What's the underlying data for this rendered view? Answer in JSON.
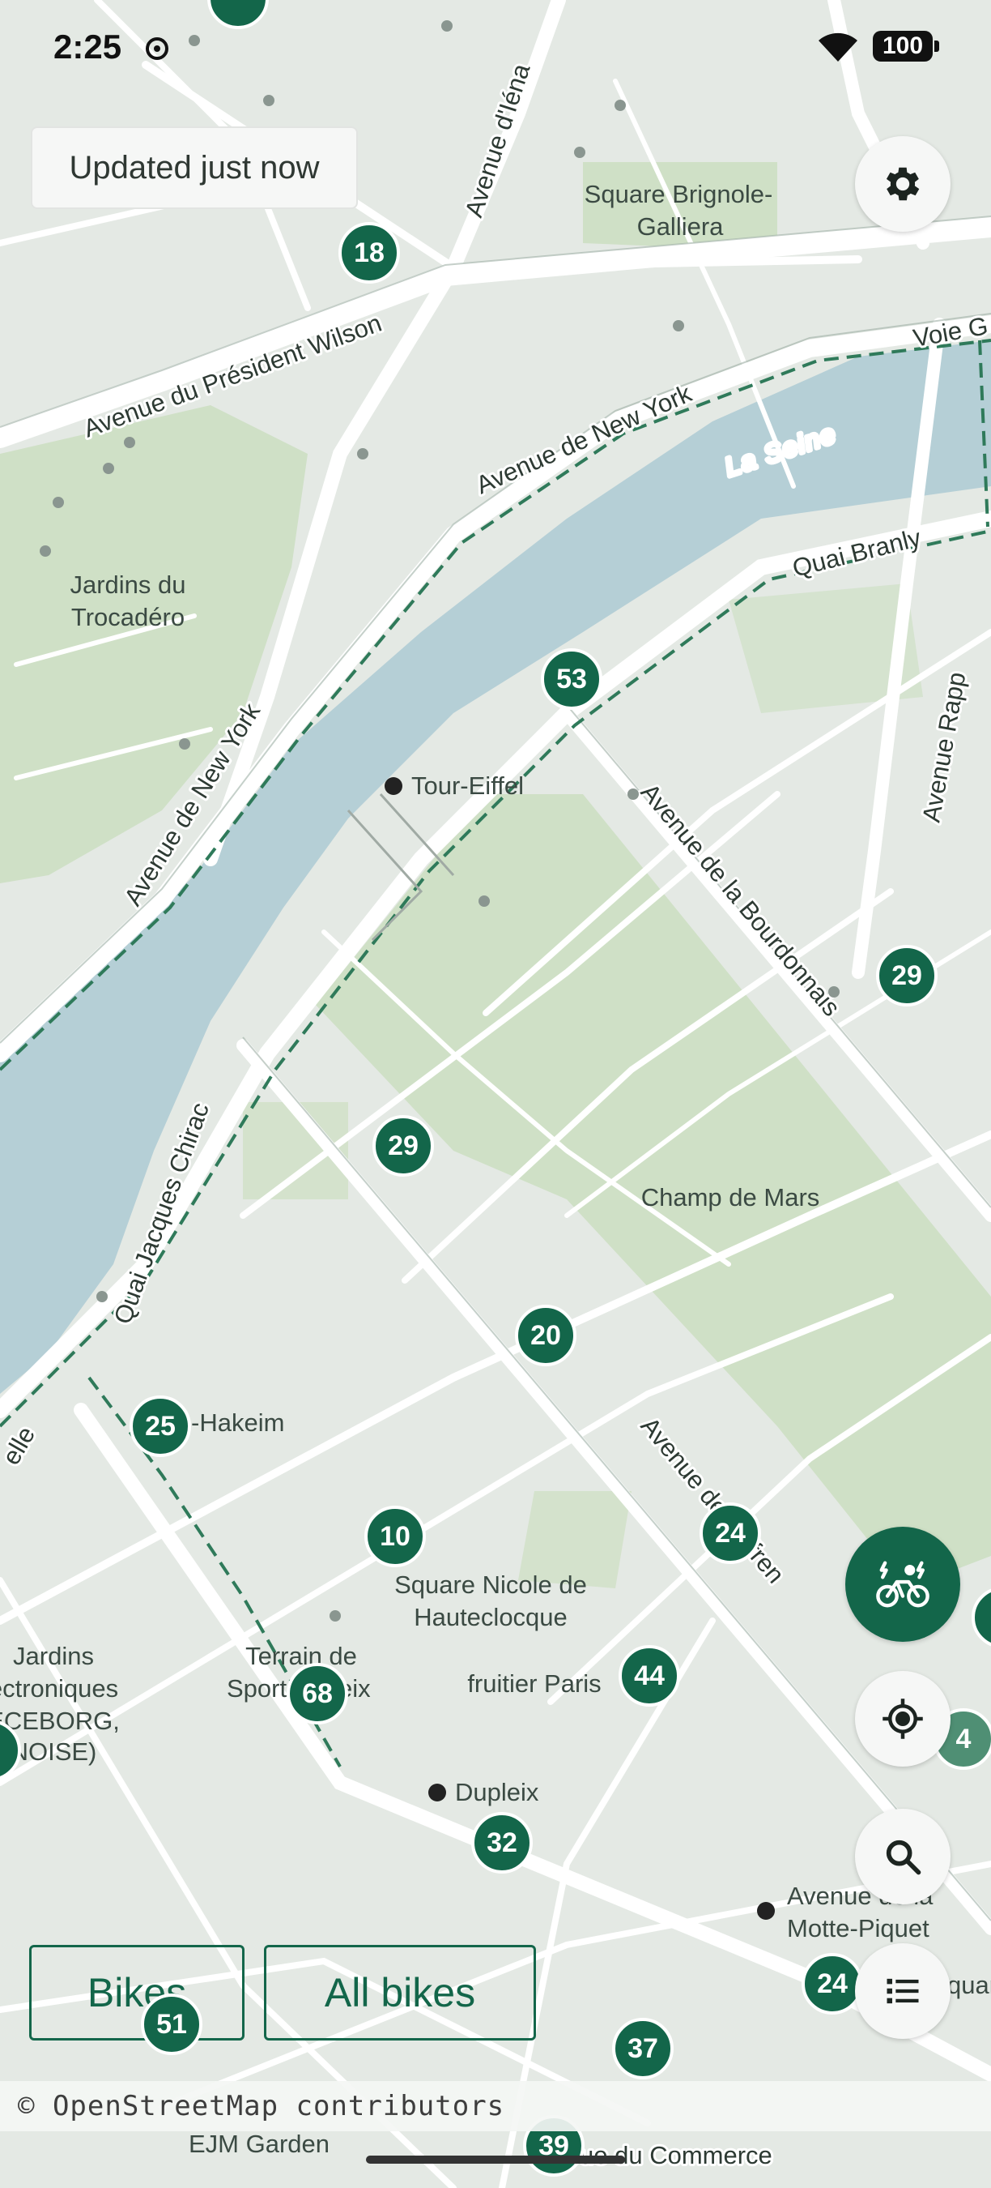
{
  "status_bar": {
    "time": "2:25",
    "battery": "100"
  },
  "updated_chip": "Updated just now",
  "map": {
    "water_labels": [
      "La Seine"
    ],
    "street_labels": [
      "Avenue d'Iéna",
      "Avenue du Président Wilson",
      "Avenue de New York",
      "Avenue de New York",
      "Quai Branly",
      "Avenue de la Bourdonnais",
      "Avenue Rapp",
      "Quai Jacques Chirac",
      "Avenue de Suffren",
      "Voie G",
      "Avenue de la Motte-Piquet",
      "ue du Commerce",
      "elle"
    ],
    "place_labels": {
      "square_brignole_1": "Square Brignole-",
      "square_brignole_2": "Galliera",
      "jardins_trocadero_1": "Jardins du",
      "jardins_trocadero_2": "Trocadéro",
      "tour_eiffel": "Tour-Eiffel",
      "champ_de_mars": "Champ de Mars",
      "bir_hakeim": "-Hakeim",
      "square_nicole_1": "Square Nicole de",
      "square_nicole_2": "Hauteclocque",
      "terrain_1": "Terrain de",
      "terrain_2": "Sport",
      "terrain_3": "eix",
      "fruitier": "fruitier Paris",
      "jardins_elec_1": "Jardins",
      "jardins_elec_2": "ectroniques",
      "jardins_elec_3": "ECEBORG,",
      "jardins_elec_4": "NOISE)",
      "dupleix": "Dupleix",
      "motte_piquet_1": "Avenue de la",
      "motte_piquet_2": "Motte-Piquet",
      "ejm_garden": "EJM Garden",
      "quar": "quar"
    },
    "stations": [
      {
        "id": "s18",
        "count": "18"
      },
      {
        "id": "s53",
        "count": "53"
      },
      {
        "id": "s29a",
        "count": "29"
      },
      {
        "id": "s29b",
        "count": "29"
      },
      {
        "id": "s20",
        "count": "20"
      },
      {
        "id": "s25",
        "count": "25"
      },
      {
        "id": "s10",
        "count": "10"
      },
      {
        "id": "s24a",
        "count": "24"
      },
      {
        "id": "s44",
        "count": "44"
      },
      {
        "id": "s68",
        "count": "68"
      },
      {
        "id": "s32",
        "count": "32"
      },
      {
        "id": "s24b",
        "count": "24"
      },
      {
        "id": "s37",
        "count": "37"
      },
      {
        "id": "s51",
        "count": "51"
      },
      {
        "id": "s39",
        "count": "39"
      },
      {
        "id": "s4",
        "count": "4"
      }
    ],
    "colors": {
      "marker": "#13664a",
      "water": "#b5cfd6",
      "park": "#cfe0c6",
      "road": "#ffffff",
      "bike_lane": "#2f7a5a"
    }
  },
  "controls": {
    "settings_icon": "gear-icon",
    "ebike_icon": "electric-bike-icon",
    "locate_icon": "crosshair-location-icon",
    "search_icon": "search-icon",
    "list_icon": "list-icon"
  },
  "filters": {
    "bikes_label": "Bikes",
    "all_bikes_label": "All bikes"
  },
  "attribution": "© OpenStreetMap contributors"
}
